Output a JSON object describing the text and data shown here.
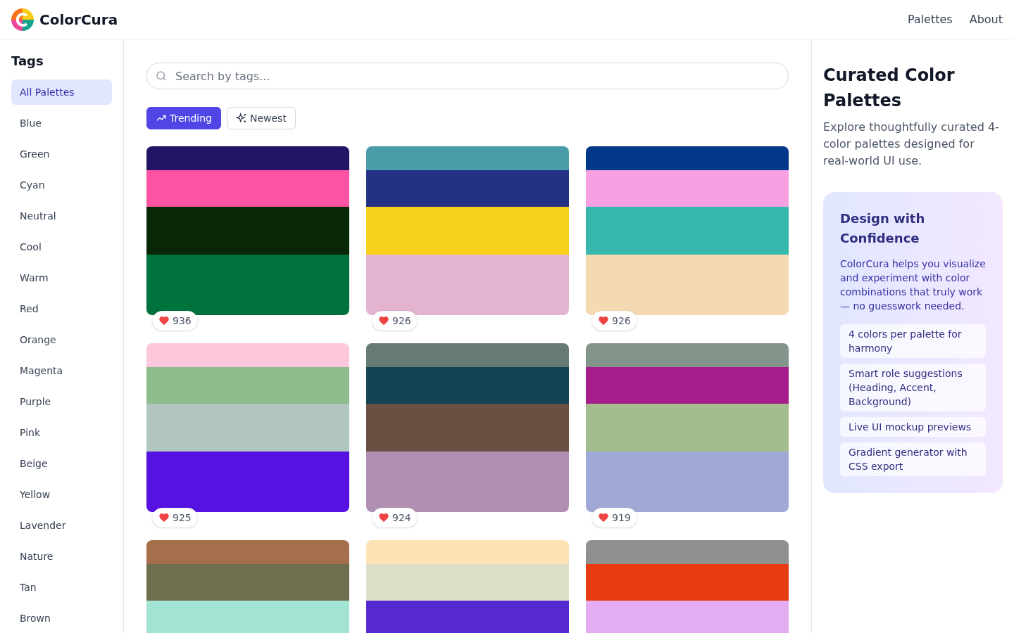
{
  "brand": "ColorCura",
  "nav": [
    "Palettes",
    "About"
  ],
  "sidebar": {
    "title": "Tags",
    "items": [
      {
        "label": "All Palettes",
        "selected": true
      },
      {
        "label": "Blue",
        "selected": false
      },
      {
        "label": "Green",
        "selected": false
      },
      {
        "label": "Cyan",
        "selected": false
      },
      {
        "label": "Neutral",
        "selected": false
      },
      {
        "label": "Cool",
        "selected": false
      },
      {
        "label": "Warm",
        "selected": false
      },
      {
        "label": "Red",
        "selected": false
      },
      {
        "label": "Orange",
        "selected": false
      },
      {
        "label": "Magenta",
        "selected": false
      },
      {
        "label": "Purple",
        "selected": false
      },
      {
        "label": "Pink",
        "selected": false
      },
      {
        "label": "Beige",
        "selected": false
      },
      {
        "label": "Yellow",
        "selected": false
      },
      {
        "label": "Lavender",
        "selected": false
      },
      {
        "label": "Nature",
        "selected": false
      },
      {
        "label": "Tan",
        "selected": false
      },
      {
        "label": "Brown",
        "selected": false
      }
    ]
  },
  "search": {
    "placeholder": "Search by tags..."
  },
  "sort": [
    {
      "label": "Trending",
      "kind": "trending",
      "selected": true
    },
    {
      "label": "Newest",
      "kind": "newest",
      "selected": false
    }
  ],
  "palettes": [
    {
      "swatches": [
        {
          "color": "#241466"
        },
        {
          "color": "#ff53a3"
        },
        {
          "color": "#082706"
        },
        {
          "color": "#00733c"
        }
      ],
      "likes": "936"
    },
    {
      "swatches": [
        {
          "color": "#4b9ca9"
        },
        {
          "color": "#233384"
        },
        {
          "color": "#f8d21a"
        },
        {
          "color": "#e3b3cf"
        }
      ],
      "likes": "926"
    },
    {
      "swatches": [
        {
          "color": "#02388a"
        },
        {
          "color": "#f9a0e3"
        },
        {
          "color": "#37b8ae"
        },
        {
          "color": "#f4d9b2"
        }
      ],
      "likes": "926"
    },
    {
      "swatches": [
        {
          "color": "#fdc7dc"
        },
        {
          "color": "#8fbc8d"
        },
        {
          "color": "#b0c6bf"
        },
        {
          "color": "#5512e0"
        }
      ],
      "likes": "925"
    },
    {
      "swatches": [
        {
          "color": "#667c73"
        },
        {
          "color": "#134456"
        },
        {
          "color": "#6a4f43"
        },
        {
          "color": "#b08fb2"
        }
      ],
      "likes": "924"
    },
    {
      "swatches": [
        {
          "color": "#83948a"
        },
        {
          "color": "#a81d8d"
        },
        {
          "color": "#a4bd8e"
        },
        {
          "color": "#a0a8d6"
        }
      ],
      "likes": "919"
    },
    {
      "swatches": [
        {
          "color": "#a66f4b"
        },
        {
          "color": "#6d6f4f"
        },
        {
          "color": "#a2e3d3"
        }
      ]
    },
    {
      "swatches": [
        {
          "color": "#fde2b3"
        },
        {
          "color": "#dddfc9"
        },
        {
          "color": "#5628cf"
        }
      ]
    },
    {
      "swatches": [
        {
          "color": "#8f9190"
        },
        {
          "color": "#e83b12"
        },
        {
          "color": "#e5adf1"
        }
      ]
    }
  ],
  "aside": {
    "title": "Curated Color Palettes",
    "description": "Explore thoughtfully curated 4-color palettes designed for real-world UI use.",
    "card": {
      "title": "Design with Confidence",
      "text": "ColorCura helps you visualize and experiment with color combinations that truly work — no guesswork needed.",
      "features": [
        "4 colors per palette for harmony",
        "Smart role suggestions (Heading, Accent, Background)",
        "Live UI mockup previews",
        "Gradient generator with CSS export"
      ]
    }
  }
}
